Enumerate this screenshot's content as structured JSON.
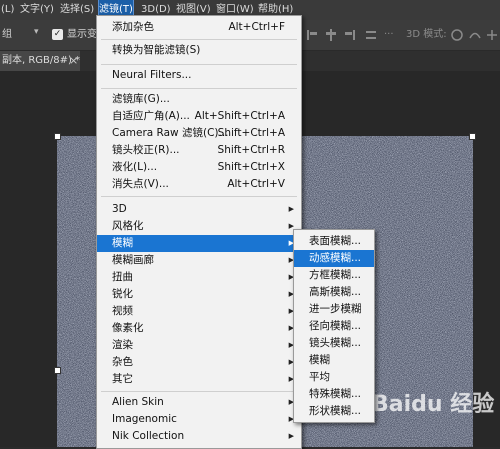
{
  "menubar": {
    "items": [
      "(L)",
      "文字(Y)",
      "选择(S)",
      "滤镜(T)",
      "3D(D)",
      "视图(V)",
      "窗口(W)",
      "帮助(H)"
    ],
    "active_index": 3
  },
  "options": {
    "group_label": "组",
    "show_transform_label": "显示变",
    "mode_3d": "3D 模式:"
  },
  "document_tab": {
    "title": "副本, RGB/8#) *",
    "close": "×"
  },
  "filter_menu": {
    "items": [
      {
        "label": "添加杂色",
        "shortcut": "Alt+Ctrl+F"
      },
      {
        "label": "转换为智能滤镜(S)"
      },
      {
        "label": "Neural Filters..."
      },
      {
        "label": "滤镜库(G)..."
      },
      {
        "label": "自适应广角(A)...",
        "shortcut": "Alt+Shift+Ctrl+A"
      },
      {
        "label": "Camera Raw 滤镜(C)...",
        "shortcut": "Shift+Ctrl+A"
      },
      {
        "label": "镜头校正(R)...",
        "shortcut": "Shift+Ctrl+R"
      },
      {
        "label": "液化(L)...",
        "shortcut": "Shift+Ctrl+X"
      },
      {
        "label": "消失点(V)...",
        "shortcut": "Alt+Ctrl+V"
      },
      {
        "label": "3D",
        "submenu": true
      },
      {
        "label": "风格化",
        "submenu": true
      },
      {
        "label": "模糊",
        "submenu": true,
        "highlighted": true
      },
      {
        "label": "模糊画廊",
        "submenu": true
      },
      {
        "label": "扭曲",
        "submenu": true
      },
      {
        "label": "锐化",
        "submenu": true
      },
      {
        "label": "视频",
        "submenu": true
      },
      {
        "label": "像素化",
        "submenu": true
      },
      {
        "label": "渲染",
        "submenu": true
      },
      {
        "label": "杂色",
        "submenu": true
      },
      {
        "label": "其它",
        "submenu": true
      },
      {
        "label": "Alien Skin",
        "submenu": true
      },
      {
        "label": "Imagenomic",
        "submenu": true
      },
      {
        "label": "Nik Collection",
        "submenu": true
      }
    ]
  },
  "blur_submenu": {
    "items": [
      {
        "label": "表面模糊..."
      },
      {
        "label": "动感模糊...",
        "highlighted": true
      },
      {
        "label": "方框模糊..."
      },
      {
        "label": "高斯模糊..."
      },
      {
        "label": "进一步模糊"
      },
      {
        "label": "径向模糊..."
      },
      {
        "label": "镜头模糊..."
      },
      {
        "label": "模糊"
      },
      {
        "label": "平均"
      },
      {
        "label": "特殊模糊..."
      },
      {
        "label": "形状模糊..."
      }
    ]
  },
  "watermark": "Baidu 经验"
}
